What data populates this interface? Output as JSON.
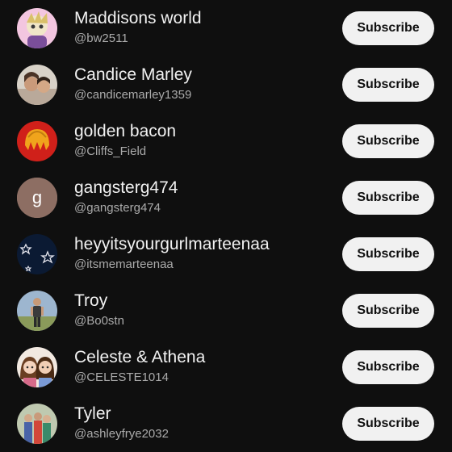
{
  "subscribe_label": "Subscribe",
  "channels": [
    {
      "name": "Maddisons world",
      "handle": "@bw2511",
      "avatar": "cartoon-character-avatar"
    },
    {
      "name": "Candice Marley",
      "handle": "@candicemarley1359",
      "avatar": "photo-avatar"
    },
    {
      "name": "golden bacon",
      "handle": "@Cliffs_Field",
      "avatar": "golden-hair-avatar"
    },
    {
      "name": "gangsterg474",
      "handle": "@gangsterg474",
      "avatar": "letter-avatar",
      "letter": "g"
    },
    {
      "name": "heyyitsyourgurlmarteenaa",
      "handle": "@itsmemarteenaa",
      "avatar": "stars-avatar"
    },
    {
      "name": "Troy",
      "handle": "@Bo0stn",
      "avatar": "photo-avatar"
    },
    {
      "name": "Celeste & Athena",
      "handle": "@CELESTE1014",
      "avatar": "cartoon-girls-avatar"
    },
    {
      "name": "Tyler",
      "handle": "@ashleyfrye2032",
      "avatar": "group-photo-avatar"
    }
  ],
  "colors": {
    "background": "#0f0f0f",
    "name_text": "#f1f1f1",
    "handle_text": "#aaaaaa",
    "button_bg": "#f1f1f1",
    "button_text": "#0f0f0f",
    "letter_avatar_bg": "#8d6e63"
  }
}
